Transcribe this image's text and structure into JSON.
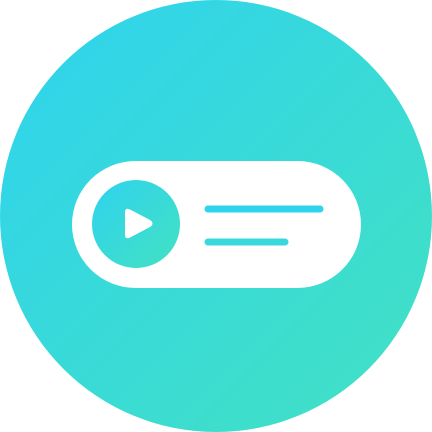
{
  "icon": {
    "name": "media-player-pill-icon",
    "colors": {
      "gradient_start": "#2ED3EE",
      "gradient_end": "#43E1C2",
      "foreground": "#FFFFFF"
    },
    "parts": {
      "badge": "circle-badge",
      "pill": "player-pill",
      "play_button": "play-button-icon",
      "text_lines": [
        "title-line",
        "subtitle-line"
      ]
    }
  }
}
